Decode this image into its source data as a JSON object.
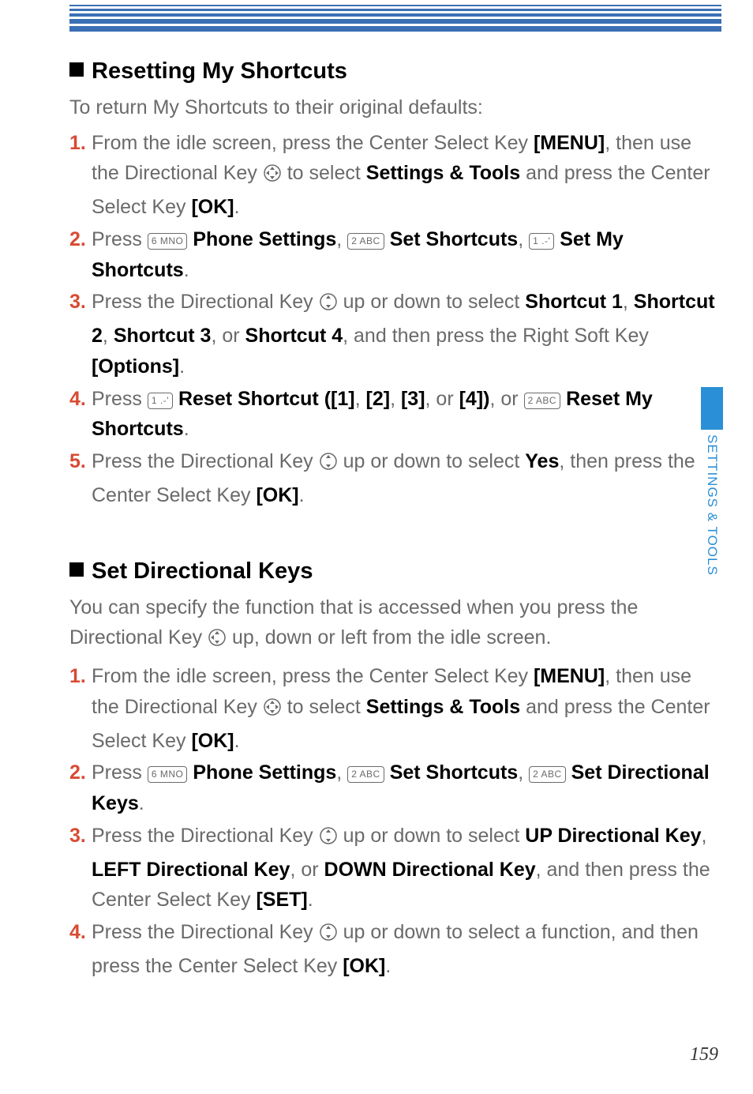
{
  "sideTab": "SETTINGS & TOOLS",
  "pageNumber": "159",
  "section1": {
    "title": "Resetting My Shortcuts",
    "intro": "To return My Shortcuts to their original defaults:",
    "steps": {
      "s1": {
        "n": "1.",
        "t1": "From the idle screen, press the Center Select Key ",
        "menu": "[MENU]",
        "t2": ", then use the Directional Key ",
        "t3": " to select ",
        "settings": "Settings & Tools",
        "t4": " and press the Center Select Key ",
        "ok": "[OK]",
        "t5": "."
      },
      "s2": {
        "n": "2.",
        "t1": "Press ",
        "k1": "6 MNO",
        "ps": "Phone Settings",
        "t2": ", ",
        "k2": "2 ABC",
        "ss": "Set Shortcuts",
        "t3": ", ",
        "k3": "1 .-'",
        "sm": "Set My Shortcuts",
        "t4": "."
      },
      "s3": {
        "n": "3.",
        "t1": "Press the Directional Key ",
        "t2": " up or down to select ",
        "sc1": "Shortcut 1",
        "t3": ", ",
        "sc2": "Shortcut 2",
        "t4": ", ",
        "sc3": "Shortcut 3",
        "t5": ", or ",
        "sc4": "Shortcut 4",
        "t6": ", and then press the Right Soft Key ",
        "opt": "[Options]",
        "t7": "."
      },
      "s4": {
        "n": "4.",
        "t1": "Press ",
        "k1": "1 .-'",
        "rs": "Reset Shortcut ([1]",
        "t2": ", ",
        "p2": "[2]",
        "t3": ", ",
        "p3": "[3]",
        "t4": ", or ",
        "p4": "[4])",
        "t5": ", or ",
        "k2": "2 ABC",
        "rm": "Reset My Shortcuts",
        "t6": "."
      },
      "s5": {
        "n": "5.",
        "t1": "Press the Directional Key ",
        "t2": " up or down to select ",
        "yes": "Yes",
        "t3": ", then press the Center Select Key ",
        "ok": "[OK]",
        "t4": "."
      }
    }
  },
  "section2": {
    "title": "Set Directional Keys",
    "intro1": "You can specify the function that is accessed when you press the Directional Key ",
    "intro2": " up, down or left from the idle screen.",
    "steps": {
      "s1": {
        "n": "1.",
        "t1": "From the idle screen, press the Center Select Key ",
        "menu": "[MENU]",
        "t2": ", then use the Directional Key ",
        "t3": " to select ",
        "settings": "Settings & Tools",
        "t4": " and press the Center Select Key ",
        "ok": "[OK]",
        "t5": "."
      },
      "s2": {
        "n": "2.",
        "t1": "Press ",
        "k1": "6 MNO",
        "ps": "Phone Settings",
        "t2": ", ",
        "k2": "2 ABC",
        "ss": "Set Shortcuts",
        "t3": ", ",
        "k3": "2 ABC",
        "sd": "Set Directional Keys",
        "t4": "."
      },
      "s3": {
        "n": "3.",
        "t1": "Press the Directional Key ",
        "t2": " up or down to select ",
        "up": "UP Directional Key",
        "t3": ", ",
        "left": "LEFT Directional Key",
        "t4": ", or ",
        "down": "DOWN Directional Key",
        "t5": ", and then press the Center Select Key ",
        "set": "[SET]",
        "t6": "."
      },
      "s4": {
        "n": "4.",
        "t1": "Press the Directional Key ",
        "t2": " up or down to select a function, and then press the Center Select Key ",
        "ok": "[OK]",
        "t3": "."
      }
    }
  }
}
